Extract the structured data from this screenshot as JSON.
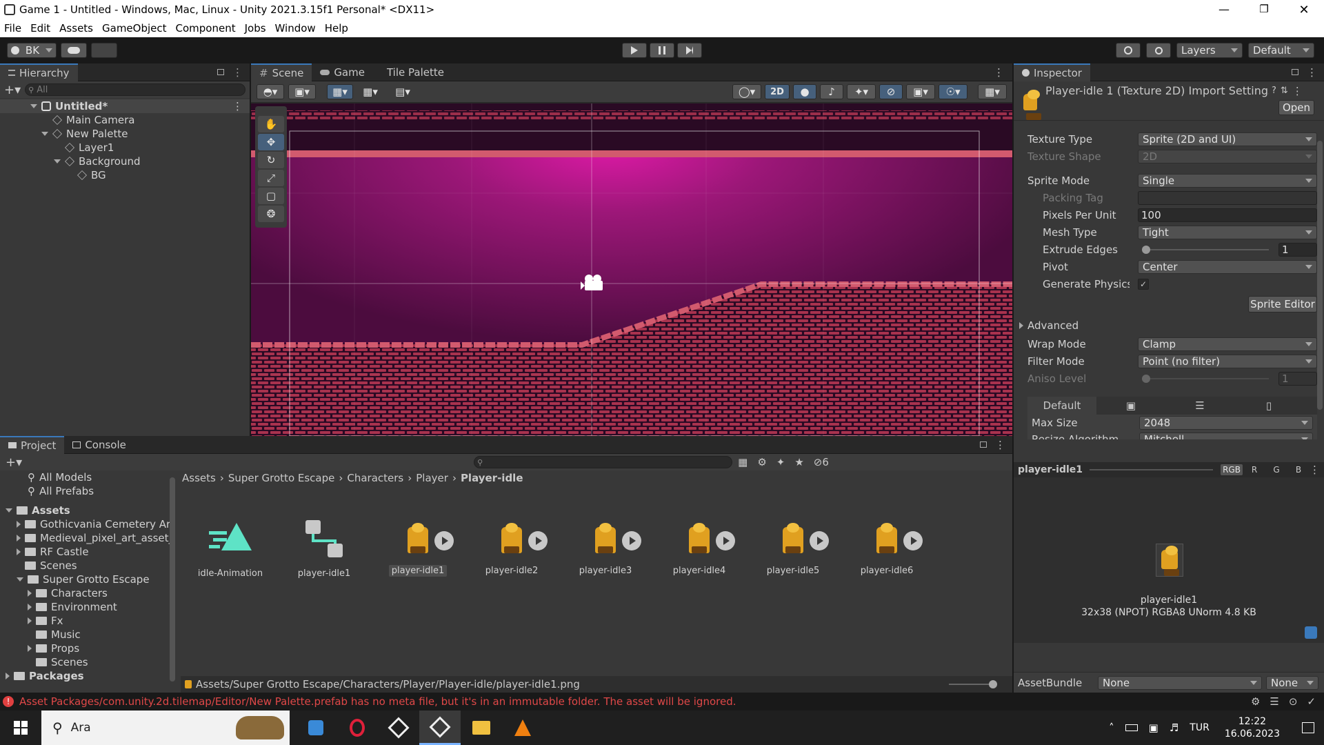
{
  "window": {
    "title": "Game 1 - Untitled - Windows, Mac, Linux - Unity 2021.3.15f1 Personal* <DX11>"
  },
  "menu": [
    "File",
    "Edit",
    "Assets",
    "GameObject",
    "Component",
    "Jobs",
    "Window",
    "Help"
  ],
  "toolbar": {
    "account": "BK",
    "layers": "Layers",
    "layout": "Default"
  },
  "hierarchy": {
    "tab": "Hierarchy",
    "search_placeholder": "All",
    "items": [
      "Untitled*",
      "Main Camera",
      "New Palette",
      "Layer1",
      "Background",
      "BG"
    ]
  },
  "scene": {
    "tabs": [
      "Scene",
      "Game",
      "Tile Palette"
    ],
    "mode_2d": "2D"
  },
  "inspector": {
    "tab": "Inspector",
    "title": "Player-idle 1 (Texture 2D) Import Settings",
    "open": "Open",
    "rows": [
      {
        "label": "Texture Type",
        "value": "Sprite (2D and UI)"
      },
      {
        "label": "Texture Shape",
        "value": "2D"
      },
      {
        "label": "Sprite Mode",
        "value": "Single"
      },
      {
        "label": "Packing Tag",
        "value": ""
      },
      {
        "label": "Pixels Per Unit",
        "value": "100"
      },
      {
        "label": "Mesh Type",
        "value": "Tight"
      },
      {
        "label": "Extrude Edges",
        "value": "1"
      },
      {
        "label": "Pivot",
        "value": "Center"
      },
      {
        "label": "Generate Physics Shape",
        "value": "✓"
      }
    ],
    "sprite_editor": "Sprite Editor",
    "advanced": "Advanced",
    "rows2": [
      {
        "label": "Wrap Mode",
        "value": "Clamp"
      },
      {
        "label": "Filter Mode",
        "value": "Point (no filter)"
      },
      {
        "label": "Aniso Level",
        "value": "1"
      }
    ],
    "platform_tab": "Default",
    "rows3": [
      {
        "label": "Max Size",
        "value": "2048"
      },
      {
        "label": "Resize Algorithm",
        "value": "Mitchell"
      }
    ],
    "preview": {
      "name": "player-idle1",
      "channels": [
        "RGB",
        "R",
        "G",
        "B"
      ],
      "caption_name": "player-idle1",
      "caption_info": "32x38 (NPOT)  RGBA8 UNorm   4.8 KB"
    },
    "assetbundle": {
      "label": "AssetBundle",
      "value": "None",
      "variant": "None"
    }
  },
  "project": {
    "tabs": [
      "Project",
      "Console"
    ],
    "favorites": [
      "All Models",
      "All Prefabs"
    ],
    "tree": [
      {
        "label": "Assets",
        "level": 0
      },
      {
        "label": "Gothicvania Cemetery Ar",
        "level": 1
      },
      {
        "label": "Medieval_pixel_art_asset_",
        "level": 1
      },
      {
        "label": "RF Castle",
        "level": 1
      },
      {
        "label": "Scenes",
        "level": 1
      },
      {
        "label": "Super Grotto Escape",
        "level": 1
      },
      {
        "label": "Characters",
        "level": 2
      },
      {
        "label": "Environment",
        "level": 2
      },
      {
        "label": "Fx",
        "level": 2
      },
      {
        "label": "Music",
        "level": 2
      },
      {
        "label": "Props",
        "level": 2
      },
      {
        "label": "Scenes",
        "level": 2
      },
      {
        "label": "Packages",
        "level": 0
      }
    ],
    "breadcrumb": [
      "Assets",
      "Super Grotto Escape",
      "Characters",
      "Player",
      "Player-idle"
    ],
    "assets": [
      "idle-Animation",
      "player-idle1",
      "player-idle1",
      "player-idle2",
      "player-idle3",
      "player-idle4",
      "player-idle5",
      "player-idle6"
    ],
    "hidden_count": "6",
    "path": "Assets/Super Grotto Escape/Characters/Player/Player-idle/player-idle1.png"
  },
  "status": {
    "message": "Asset Packages/com.unity.2d.tilemap/Editor/New Palette.prefab has no meta file, but it's in an immutable folder. The asset will be ignored."
  },
  "taskbar": {
    "search": "Ara",
    "lang": "TUR",
    "time": "12:22",
    "date": "16.06.2023"
  }
}
